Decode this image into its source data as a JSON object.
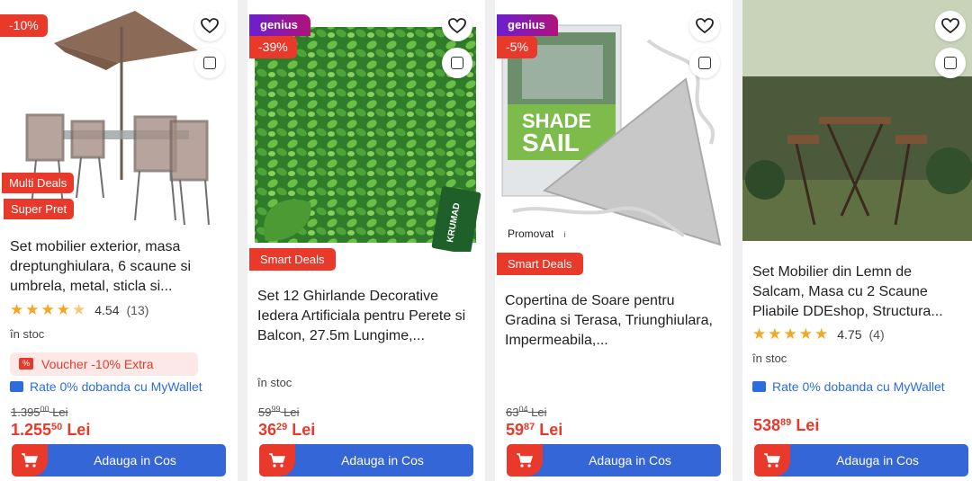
{
  "cards": [
    {
      "discount": "-10%",
      "tags": [
        "Multi Deals",
        "Super Pret"
      ],
      "title": "Set mobilier exterior, masa dreptunghiulara, 6 scaune si umbrela, metal, sticla si...",
      "rating": "4.54",
      "reviews": "(13)",
      "stock": "în stoc",
      "voucher": "Voucher -10% Extra",
      "rate": "Rate 0% dobanda cu MyWallet",
      "old_price_int": "1.395",
      "old_price_dec": "00",
      "old_price_cur": "Lei",
      "price_int": "1.255",
      "price_dec": "50",
      "price_cur": "Lei",
      "cart": "Adauga in Cos"
    },
    {
      "genius": "genius",
      "discount": "-39%",
      "tag": "Smart Deals",
      "title": "Set 12 Ghirlande Decorative Iedera Artificiala pentru Perete si Balcon, 27.5m Lungime,...",
      "stock": "în stoc",
      "old_price_int": "59",
      "old_price_dec": "99",
      "old_price_cur": "Lei",
      "price_int": "36",
      "price_dec": "29",
      "price_cur": "Lei",
      "cart": "Adauga in Cos",
      "img_text": "KRUMAD"
    },
    {
      "genius": "genius",
      "discount": "-5%",
      "promo": "Promovat",
      "promo_info": "i",
      "tag": "Smart Deals",
      "title": "Copertina de Soare pentru Gradina si Terasa, Triunghiulara, Impermeabila,...",
      "old_price_int": "63",
      "old_price_dec": "04",
      "old_price_cur": "Lei",
      "price_int": "59",
      "price_dec": "87",
      "price_cur": "Lei",
      "cart": "Adauga in Cos",
      "img_text_1": "SHADE",
      "img_text_2": "SAIL"
    },
    {
      "title": "Set Mobilier din Lemn de Salcam, Masa cu 2 Scaune Pliabile DDEshop, Structura...",
      "rating": "4.75",
      "reviews": "(4)",
      "stock": "în stoc",
      "rate": "Rate 0% dobanda cu MyWallet",
      "price_int": "538",
      "price_dec": "89",
      "price_cur": "Lei",
      "cart": "Adauga in Cos"
    }
  ],
  "colors": {
    "accent_red": "#e8392a",
    "accent_blue": "#3466d8",
    "star": "#f5a623"
  },
  "icons": [
    "heart-icon",
    "compare-checkbox-icon",
    "cart-icon",
    "voucher-icon",
    "wallet-icon",
    "star-icon"
  ]
}
